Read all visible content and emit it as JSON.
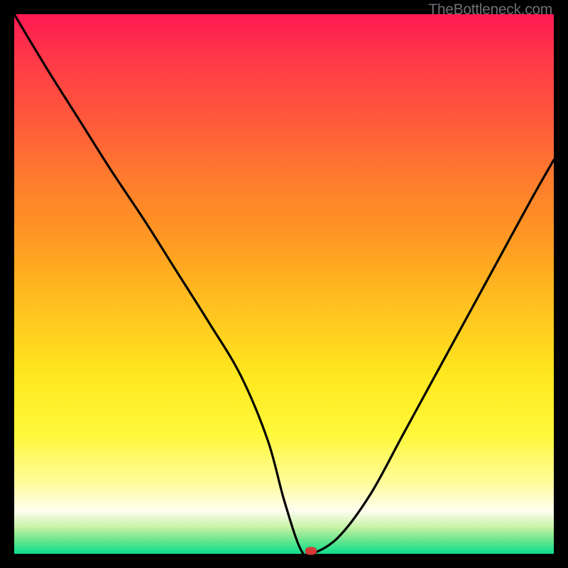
{
  "watermark": "TheBottleneck.com",
  "chart_data": {
    "type": "line",
    "title": "",
    "xlabel": "",
    "ylabel": "",
    "xlim": [
      0,
      100
    ],
    "ylim": [
      0,
      100
    ],
    "x": [
      0,
      6,
      12,
      18,
      24,
      30,
      36,
      42,
      47,
      50,
      53,
      55,
      60,
      66,
      72,
      78,
      84,
      90,
      96,
      100
    ],
    "values": [
      100,
      90,
      80.5,
      71,
      62,
      52.5,
      43,
      33,
      21,
      10,
      1,
      0,
      3,
      11,
      22,
      33,
      44,
      55,
      66,
      73
    ],
    "marker": {
      "x": 55,
      "y": 0.5
    },
    "gradient_stops": [
      {
        "pos": 0,
        "color": "#ff1a53"
      },
      {
        "pos": 50,
        "color": "#ffc41f"
      },
      {
        "pos": 78,
        "color": "#fff83b"
      },
      {
        "pos": 100,
        "color": "#10d98c"
      }
    ]
  }
}
